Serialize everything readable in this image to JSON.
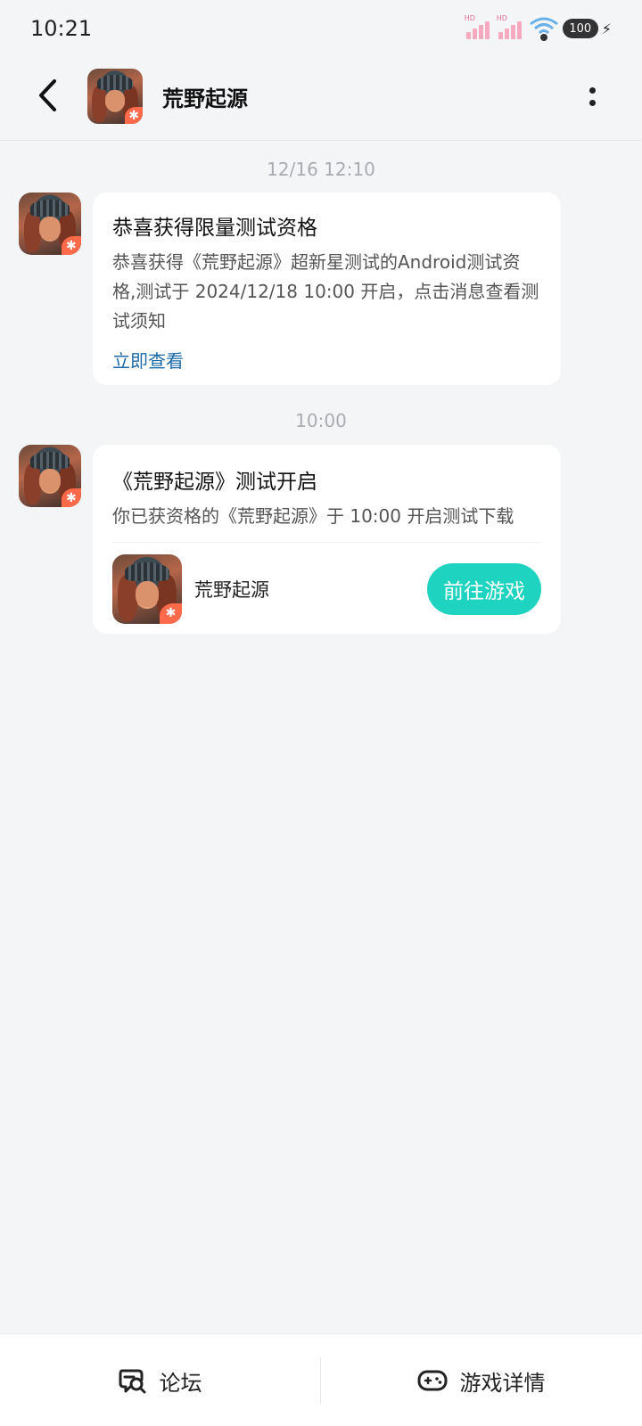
{
  "status_bar": {
    "time": "10:21",
    "battery": "100",
    "icons": [
      "hd-signal-icon",
      "hd-signal-icon",
      "wifi-icon",
      "battery-icon",
      "charging-icon"
    ]
  },
  "header": {
    "title": "荒野起源",
    "back_icon": "back-chevron-icon",
    "more_icon": "more-vertical-icon"
  },
  "messages": [
    {
      "timestamp": "12/16  12:10",
      "title": "恭喜获得限量测试资格",
      "body": "恭喜获得《荒野起源》超新星测试的Android测试资格,测试于 2024/12/18 10:00 开启，点击消息查看测试须知",
      "link": "立即查看"
    },
    {
      "timestamp": "10:00",
      "title": "《荒野起源》测试开启",
      "body": "你已获资格的《荒野起源》于 10:00 开启测试下载",
      "game_name": "荒野起源",
      "button": "前往游戏"
    }
  ],
  "bottom_bar": {
    "forum_label": "论坛",
    "game_detail_label": "游戏详情"
  },
  "colors": {
    "accent": "#1ed3bf",
    "link": "#1e6aa8",
    "background": "#f4f5f7"
  }
}
